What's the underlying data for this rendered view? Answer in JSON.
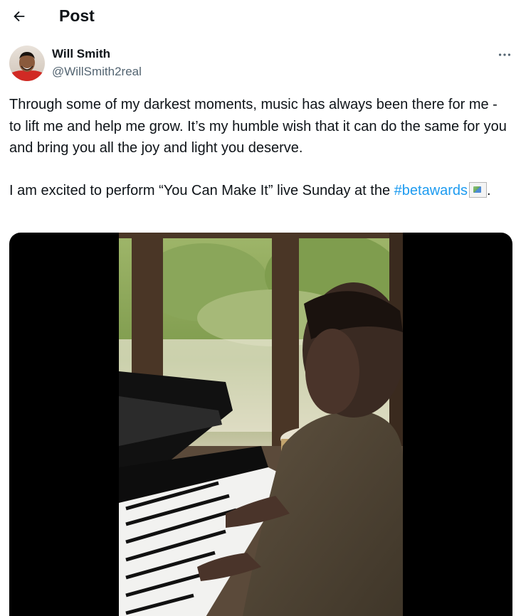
{
  "header": {
    "title": "Post"
  },
  "author": {
    "name": "Will Smith",
    "handle": "@WillSmith2real"
  },
  "tweet": {
    "paragraph1": "Through some of my darkest moments, music has always been there for me - to lift me and help me grow.  It’s my humble wish that it can do the same for you and bring you all the joy and light you deserve.",
    "paragraph2_text": "I am excited to perform “You Can Make It” live Sunday at the ",
    "hashtag": "#betawards",
    "paragraph2_end": "."
  },
  "colors": {
    "text": "#0f1419",
    "secondary_text": "#536471",
    "link": "#1d9bf0",
    "media_bg": "#000000"
  },
  "icons": {
    "back": "arrow-left-icon",
    "more": "more-horizontal-icon"
  }
}
